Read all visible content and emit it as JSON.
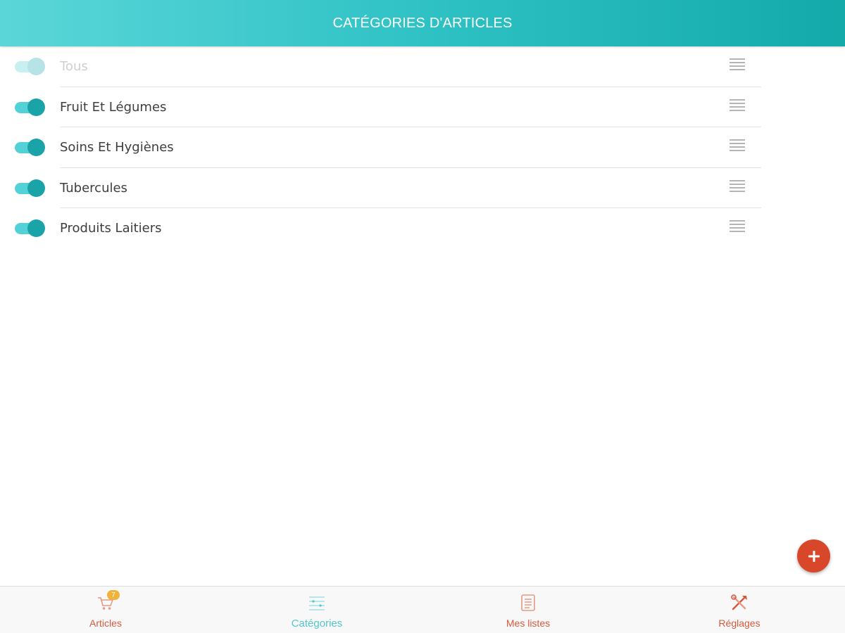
{
  "header": {
    "title": "CATÉGORIES D'ARTICLES"
  },
  "categories": [
    {
      "label": "Tous",
      "enabled": true,
      "dimmed": true
    },
    {
      "label": "Fruit Et Légumes",
      "enabled": true,
      "dimmed": false
    },
    {
      "label": "Soins Et Hygiènes",
      "enabled": true,
      "dimmed": false
    },
    {
      "label": "Tubercules",
      "enabled": true,
      "dimmed": false
    },
    {
      "label": "Produits Laitiers",
      "enabled": true,
      "dimmed": false
    }
  ],
  "fab": {
    "icon": "plus-icon"
  },
  "nav": {
    "items": [
      {
        "label": "Articles",
        "icon": "cart-icon",
        "badge": "7",
        "active": false
      },
      {
        "label": "Catégories",
        "icon": "categories-list-icon",
        "active": true
      },
      {
        "label": "Mes listes",
        "icon": "document-list-icon",
        "active": false
      },
      {
        "label": "Réglages",
        "icon": "tools-icon",
        "active": false
      }
    ]
  },
  "colors": {
    "header_gradient_start": "#5bd6d8",
    "header_gradient_end": "#13a9aa",
    "toggle_track": "#52d1d6",
    "toggle_knob": "#1aa4a8",
    "fab": "#d9472b",
    "nav_inactive": "#d5593d",
    "nav_active": "#52c7cc",
    "badge": "#f0b23a"
  }
}
